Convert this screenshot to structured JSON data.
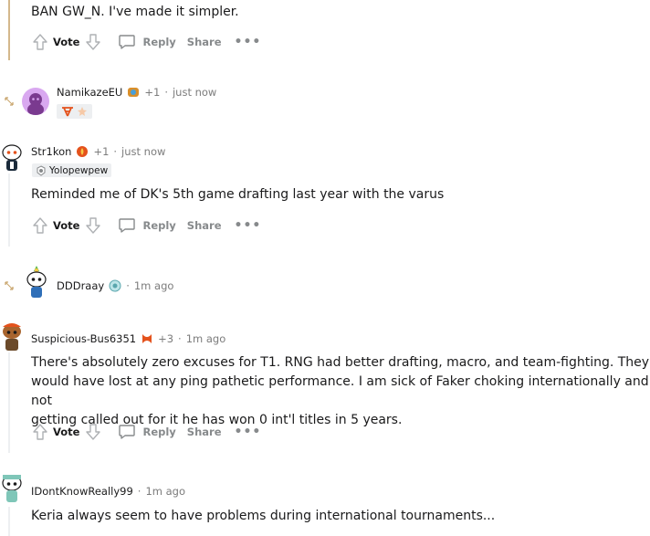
{
  "actions": {
    "vote": "Vote",
    "reply": "Reply",
    "share": "Share",
    "more": "•••"
  },
  "comments": [
    {
      "body": "BAN GW_N. I've made it simpler."
    },
    {
      "username": "NamikazeEU",
      "score": "+1",
      "separator": "·",
      "time": "just now",
      "flair_colors": [
        "#e4521c",
        "#f6c9a7"
      ]
    },
    {
      "username": "Str1kon",
      "score": "+1",
      "separator": "·",
      "time": "just now",
      "flair": "Yolopewpew",
      "body": "Reminded me of DK's 5th game drafting last year with the varus"
    },
    {
      "username": "DDDraay",
      "separator": "·",
      "time": "1m ago"
    },
    {
      "username": "Suspicious-Bus6351",
      "score": "+3",
      "separator": "·",
      "time": "1m ago",
      "body_lines": [
        "There's absolutely zero excuses for T1. RNG had better drafting, macro, and team-fighting. They",
        "would have lost at any ping pathetic performance. I am sick of Faker choking internationally and not",
        "getting called out for it he has won 0 int'l titles in 5 years."
      ]
    },
    {
      "username": "IDontKnowReally99",
      "separator": "·",
      "time": "1m ago",
      "body": "Keria always seem to have problems during international tournaments..."
    }
  ]
}
